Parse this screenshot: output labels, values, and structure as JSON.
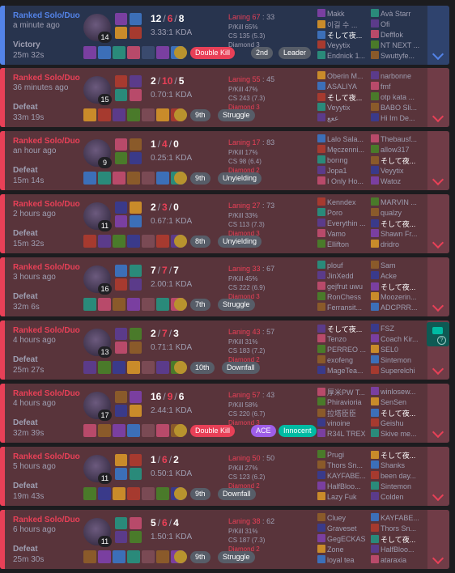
{
  "matches": [
    {
      "result_class": "win",
      "queue": "Ranked Solo/Duo",
      "time_ago": "a minute ago",
      "result": "Victory",
      "duration": "25m 32s",
      "level": "14",
      "kills": "12",
      "deaths": "6",
      "assists": "8",
      "kda_ratio": "3.33:1 KDA",
      "badges": [
        {
          "text": "Double Kill",
          "color": "red"
        },
        {
          "text": "2nd",
          "color": "gray"
        },
        {
          "text": "Leader",
          "color": "gray"
        }
      ],
      "laning_label": "Laning 67",
      "laning_opp": "33",
      "pkill": "P/Kill 65%",
      "cs": "CS 135 (5.3)",
      "rank": "Diamond 3",
      "team1": [
        "Makk",
        "이길 수 ...",
        "そして夜...",
        "Veyytix",
        "Endnick 1..."
      ],
      "team2": [
        "Avà Starr",
        "Ofi",
        "Defflok",
        "NT NEXT ...",
        "Swuttyfe..."
      ]
    },
    {
      "result_class": "loss",
      "queue": "Ranked Solo/Duo",
      "time_ago": "36 minutes ago",
      "result": "Defeat",
      "duration": "33m 19s",
      "level": "15",
      "kills": "2",
      "deaths": "10",
      "assists": "5",
      "kda_ratio": "0.70:1 KDA",
      "badges": [
        {
          "text": "9th",
          "color": "gray"
        },
        {
          "text": "Struggle",
          "color": "gray"
        }
      ],
      "laning_label": "Laning 55",
      "laning_opp": "45",
      "pkill": "P/Kill 47%",
      "cs": "CS 243 (7.3)",
      "rank": "Diamond 3",
      "team1": [
        "Oberin M...",
        "ASALIYA",
        "そして夜...",
        "Veyytix",
        "ععع"
      ],
      "team2": [
        "narbonne",
        "fmf",
        "otp kata ...",
        "BABO Sli...",
        "Hi Im De..."
      ]
    },
    {
      "result_class": "loss",
      "queue": "Ranked Solo/Duo",
      "time_ago": "an hour ago",
      "result": "Defeat",
      "duration": "15m 14s",
      "level": "9",
      "kills": "1",
      "deaths": "4",
      "assists": "0",
      "kda_ratio": "0.25:1 KDA",
      "badges": [
        {
          "text": "9th",
          "color": "gray"
        },
        {
          "text": "Unyielding",
          "color": "gray"
        }
      ],
      "laning_label": "Laning 17",
      "laning_opp": "83",
      "pkill": "P/Kill 17%",
      "cs": "CS 98 (6.4)",
      "rank": "Diamond 2",
      "team1": [
        "Lalo Sala...",
        "Męczenni...",
        "borıng",
        "Jopa1",
        "I Only Ho..."
      ],
      "team2": [
        "Thebausf...",
        "allow317",
        "そして夜...",
        "Veyytix",
        "Watoz"
      ]
    },
    {
      "result_class": "loss",
      "queue": "Ranked Solo/Duo",
      "time_ago": "2 hours ago",
      "result": "Defeat",
      "duration": "15m 32s",
      "level": "11",
      "kills": "2",
      "deaths": "3",
      "assists": "0",
      "kda_ratio": "0.67:1 KDA",
      "badges": [
        {
          "text": "8th",
          "color": "gray"
        },
        {
          "text": "Unyielding",
          "color": "gray"
        }
      ],
      "laning_label": "Laning 27",
      "laning_opp": "73",
      "pkill": "P/Kill 33%",
      "cs": "CS 113 (7.3)",
      "rank": "Diamond 3",
      "team1": [
        "Kenndex",
        "Poro",
        "Everythin ...",
        "Vamo",
        "Ellifton"
      ],
      "team2": [
        "MARVIN ...",
        "qualzy",
        "そして夜...",
        "Shawn Fr...",
        "dridro"
      ]
    },
    {
      "result_class": "loss",
      "queue": "Ranked Solo/Duo",
      "time_ago": "3 hours ago",
      "result": "Defeat",
      "duration": "32m 6s",
      "level": "16",
      "kills": "7",
      "deaths": "7",
      "assists": "7",
      "kda_ratio": "2.00:1 KDA",
      "badges": [
        {
          "text": "7th",
          "color": "gray"
        },
        {
          "text": "Struggle",
          "color": "gray"
        }
      ],
      "laning_label": "Laning 33",
      "laning_opp": "67",
      "pkill": "P/Kill 45%",
      "cs": "CS 222 (6.9)",
      "rank": "Diamond 3",
      "team1": [
        "plouf",
        "JinXedd",
        "gejfrut uwu",
        "RonChess",
        "Ferransit..."
      ],
      "team2": [
        "Sam",
        "Acke",
        "そして夜...",
        "Moozerin...",
        "ADCPRR..."
      ]
    },
    {
      "result_class": "loss",
      "queue": "Ranked Solo/Duo",
      "time_ago": "4 hours ago",
      "result": "Defeat",
      "duration": "25m 27s",
      "level": "13",
      "kills": "2",
      "deaths": "7",
      "assists": "3",
      "kda_ratio": "0.71:1 KDA",
      "badges": [
        {
          "text": "10th",
          "color": "gray"
        },
        {
          "text": "Downfall",
          "color": "gray"
        }
      ],
      "laning_label": "Laning 43",
      "laning_opp": "57",
      "pkill": "P/Kill 31%",
      "cs": "CS 183 (7.2)",
      "rank": "Diamond 2",
      "team1": [
        "そして夜...",
        "Tenzo",
        "PERREO ...",
        "exofeng",
        "MageTea..."
      ],
      "team2": [
        "FSZ",
        "Coach Kir...",
        "SEL0",
        "Sintemon",
        "Superelchi"
      ]
    },
    {
      "result_class": "loss",
      "queue": "Ranked Solo/Duo",
      "time_ago": "4 hours ago",
      "result": "Defeat",
      "duration": "32m 39s",
      "level": "17",
      "kills": "16",
      "deaths": "9",
      "assists": "6",
      "kda_ratio": "2.44:1 KDA",
      "badges": [
        {
          "text": "Double Kill",
          "color": "red"
        },
        {
          "text": "ACE",
          "color": "purple"
        },
        {
          "text": "Innocent",
          "color": "green"
        }
      ],
      "laning_label": "Laning 57",
      "laning_opp": "43",
      "pkill": "P/Kill 58%",
      "cs": "CS 220 (6.7)",
      "rank": "Diamond 3",
      "team1": [
        "厚米PW T...",
        "Phiravioria",
        "拉塔臣臣",
        "vinoine",
        "R34L TREX"
      ],
      "team2": [
        "winlosew...",
        "SenSen",
        "そして夜...",
        "Geishu",
        "Skive me..."
      ]
    },
    {
      "result_class": "loss",
      "queue": "Ranked Solo/Duo",
      "time_ago": "5 hours ago",
      "result": "Defeat",
      "duration": "19m 43s",
      "level": "11",
      "kills": "1",
      "deaths": "6",
      "assists": "2",
      "kda_ratio": "0.50:1 KDA",
      "badges": [
        {
          "text": "9th",
          "color": "gray"
        },
        {
          "text": "Downfall",
          "color": "gray"
        }
      ],
      "laning_label": "Laning 50",
      "laning_opp": "50",
      "pkill": "P/Kill 27%",
      "cs": "CS 123 (6.2)",
      "rank": "Diamond 2",
      "team1": [
        "Prugi",
        "Thors Sn...",
        "KAYFABE...",
        "HalfBloo...",
        "Lazy Fuk"
      ],
      "team2": [
        "そして夜...",
        "Shanks",
        "been day...",
        "Sintemon",
        "Colden"
      ]
    },
    {
      "result_class": "loss",
      "queue": "Ranked Solo/Duo",
      "time_ago": "6 hours ago",
      "result": "Defeat",
      "duration": "25m 30s",
      "level": "11",
      "kills": "5",
      "deaths": "6",
      "assists": "4",
      "kda_ratio": "1.50:1 KDA",
      "badges": [
        {
          "text": "9th",
          "color": "gray"
        },
        {
          "text": "Struggle",
          "color": "gray"
        }
      ],
      "laning_label": "Laning 38",
      "laning_opp": "62",
      "pkill": "P/Kill 31%",
      "cs": "CS 187 (7.3)",
      "rank": "Diamond 2",
      "team1": [
        "Cluey",
        "Graveset",
        "GegECKAS",
        "Zone",
        "loyal tea"
      ],
      "team2": [
        "KAYFABE...",
        "Thors Sn...",
        "そして夜...",
        "HalfBloo...",
        "ataraxia"
      ]
    }
  ],
  "colors": {
    "win_bg": "#28344e",
    "loss_bg": "#59343b",
    "win_accent": "#5383e8",
    "loss_accent": "#e84057",
    "badge_red": "#e84057",
    "badge_gray": "#575d68",
    "badge_purple": "#9e5ee8",
    "badge_green": "#00bba3"
  },
  "side_tab_icon": "chat-icon",
  "side_tab_help": "?"
}
